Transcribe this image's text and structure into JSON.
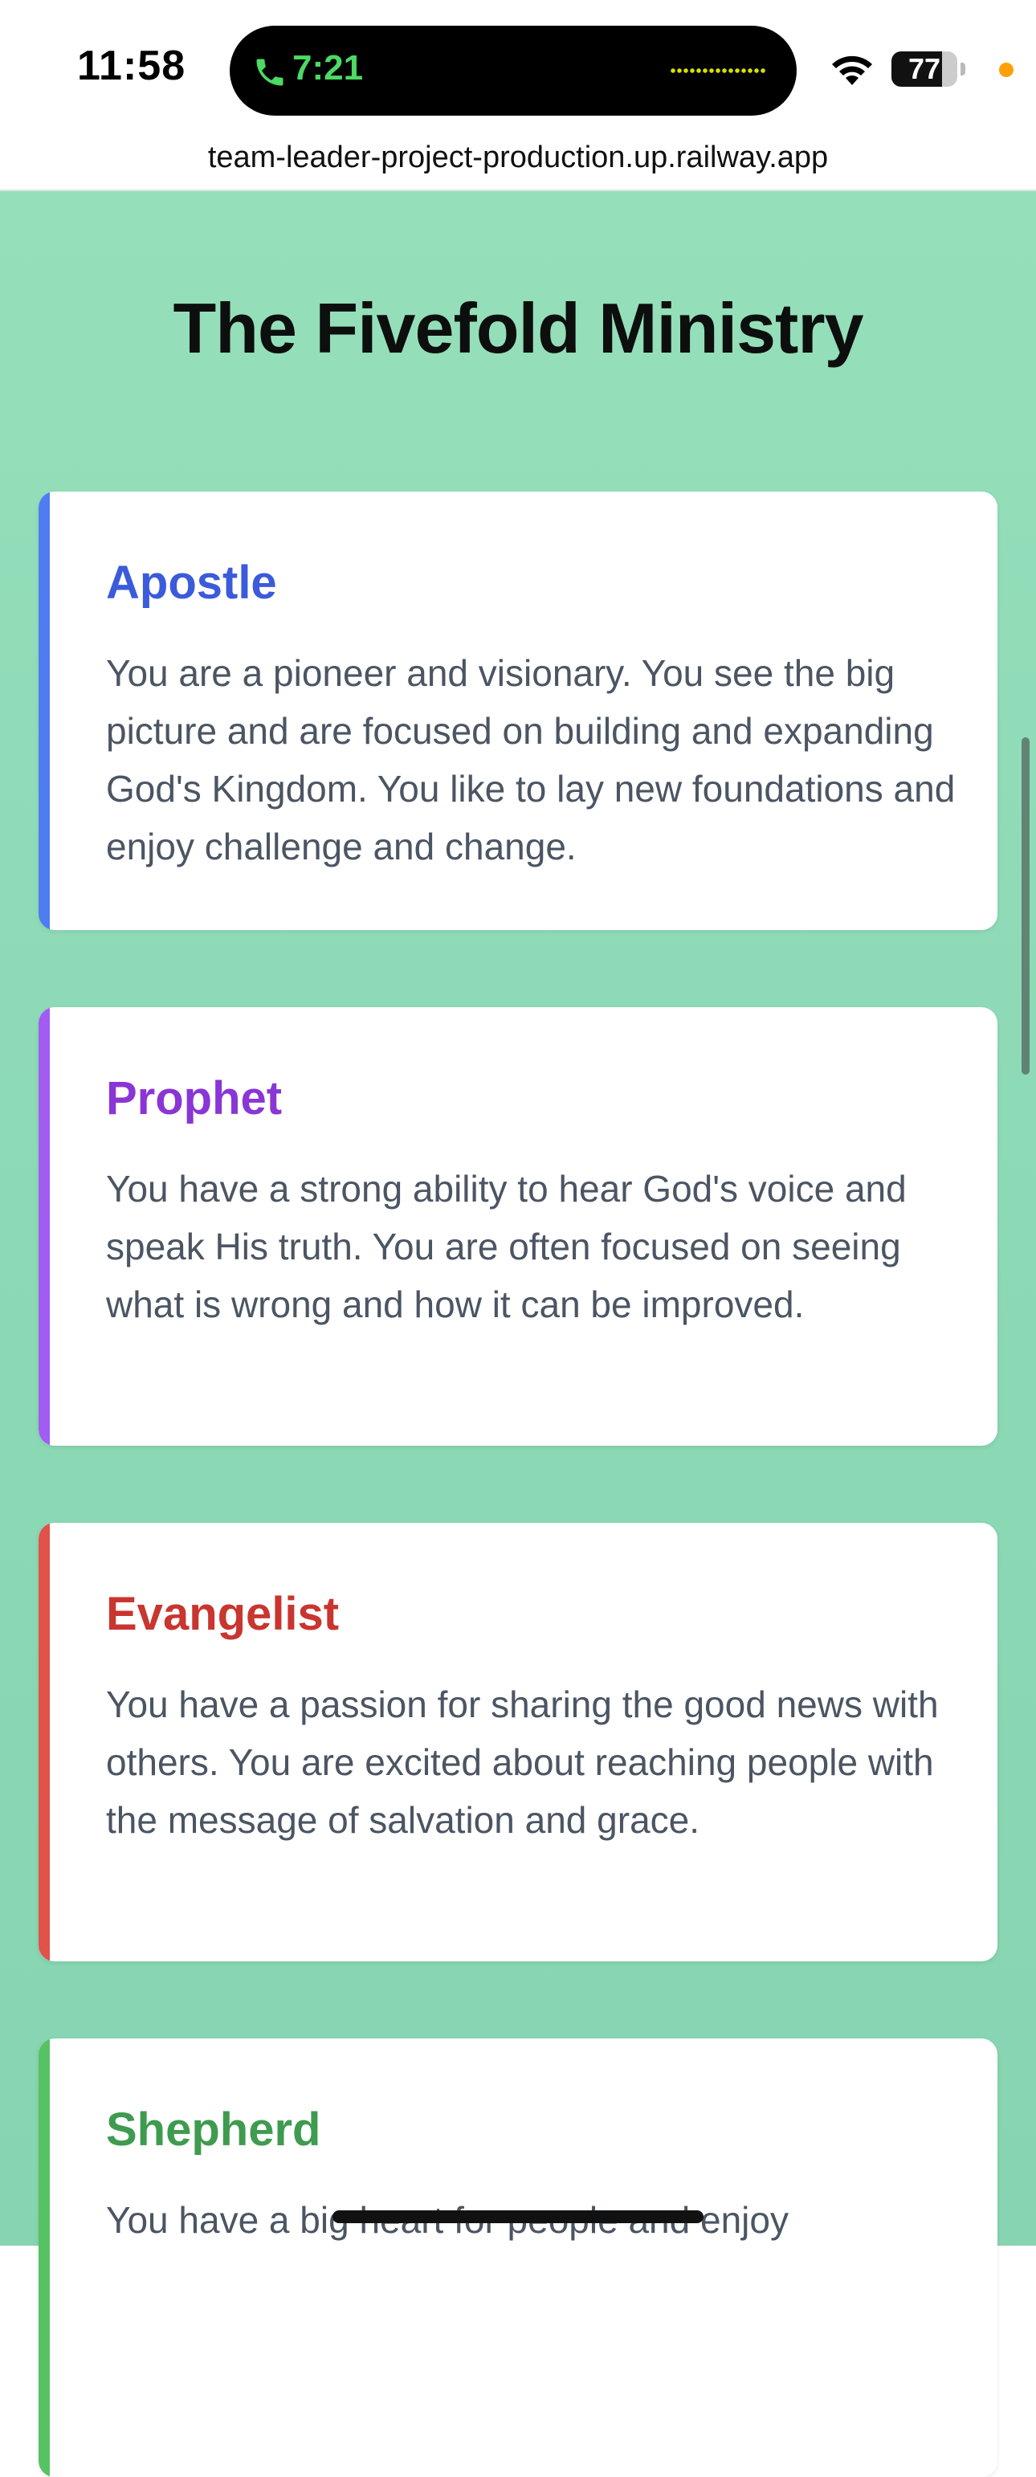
{
  "status_bar": {
    "time": "11:58",
    "call_timer": "7:21",
    "battery_level": "77",
    "call_icon": "phone-icon",
    "wifi_icon": "wifi-icon",
    "battery_icon": "battery-icon"
  },
  "browser": {
    "url": "team-leader-project-production.up.railway.app"
  },
  "page": {
    "title": "The Fivefold Ministry",
    "cards": [
      {
        "title": "Apostle",
        "color": "#3b5bdb",
        "accent": "#4f7df0",
        "text": "You are a pioneer and visionary. You see the big picture and are focused on building and expanding God's Kingdom. You like to lay new foundations and enjoy challenge and change."
      },
      {
        "title": "Prophet",
        "color": "#8a35d6",
        "accent": "#a25cf2",
        "text": "You have a strong ability to hear God's voice and speak His truth. You are often focused on seeing what is wrong and how it can be improved."
      },
      {
        "title": "Evangelist",
        "color": "#c9352f",
        "accent": "#e0524a",
        "text": "You have a passion for sharing the good news with others. You are excited about reaching people with the message of salvation and grace."
      },
      {
        "title": "Shepherd",
        "color": "#3f9b4f",
        "accent": "#56c263",
        "text": "You have a big heart for people and enjoy"
      }
    ]
  }
}
